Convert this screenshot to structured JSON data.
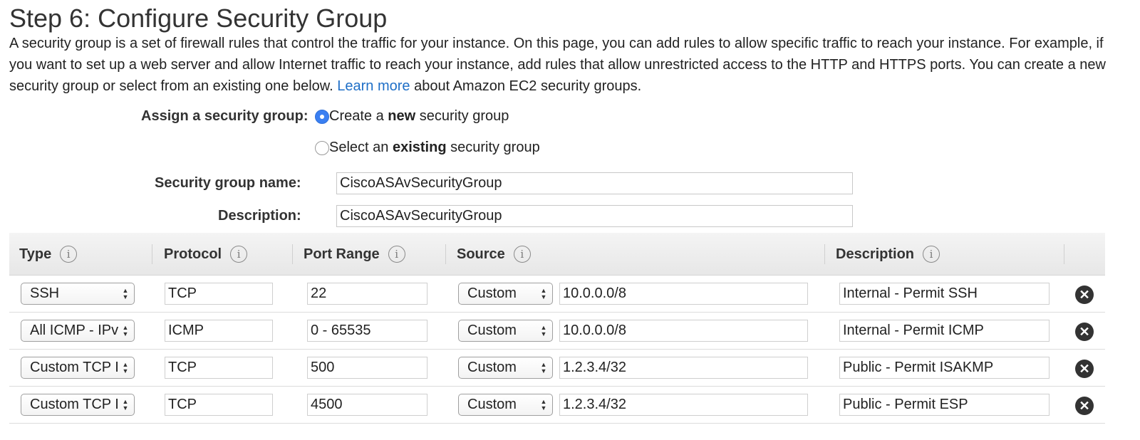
{
  "page": {
    "title": "Step 6: Configure Security Group",
    "intro_before_link": "A security group is a set of firewall rules that control the traffic for your instance. On this page, you can add rules to allow specific traffic to reach your instance. For example, if you want to set up a web server and allow Internet traffic to reach your instance, add rules that allow unrestricted access to the HTTP and HTTPS ports. You can create a new security group or select from an existing one below.",
    "learn_more": "Learn more",
    "intro_after_link": "about Amazon EC2 security groups."
  },
  "form": {
    "assign_label": "Assign a security group:",
    "option_new": {
      "prefix": "Create a ",
      "bold": "new",
      "suffix": " security group",
      "selected": true
    },
    "option_existing": {
      "prefix": "Select an ",
      "bold": "existing",
      "suffix": " security group",
      "selected": false
    },
    "name_label": "Security group name:",
    "name_value": "CiscoASAvSecurityGroup",
    "description_label": "Description:",
    "description_value": "CiscoASAvSecurityGroup"
  },
  "table": {
    "headers": {
      "type": "Type",
      "protocol": "Protocol",
      "port_range": "Port Range",
      "source": "Source",
      "description": "Description"
    },
    "info_glyph": "i",
    "remove_glyph": "✕",
    "rows": [
      {
        "type": "SSH",
        "protocol": "TCP",
        "port_range": "22",
        "source_type": "Custom",
        "source_cidr": "10.0.0.0/8",
        "description": "Internal - Permit SSH"
      },
      {
        "type": "All ICMP - IPv",
        "protocol": "ICMP",
        "port_range": "0 - 65535",
        "source_type": "Custom",
        "source_cidr": "10.0.0.0/8",
        "description": "Internal - Permit ICMP"
      },
      {
        "type": "Custom TCP I",
        "protocol": "TCP",
        "port_range": "500",
        "source_type": "Custom",
        "source_cidr": "1.2.3.4/32",
        "description": "Public - Permit ISAKMP"
      },
      {
        "type": "Custom TCP I",
        "protocol": "TCP",
        "port_range": "4500",
        "source_type": "Custom",
        "source_cidr": "1.2.3.4/32",
        "description": "Public - Permit ESP"
      }
    ]
  },
  "colors": {
    "link": "#1f6fc7",
    "radio_selected": "#3a7ff2",
    "header_bg": "#ececec"
  }
}
